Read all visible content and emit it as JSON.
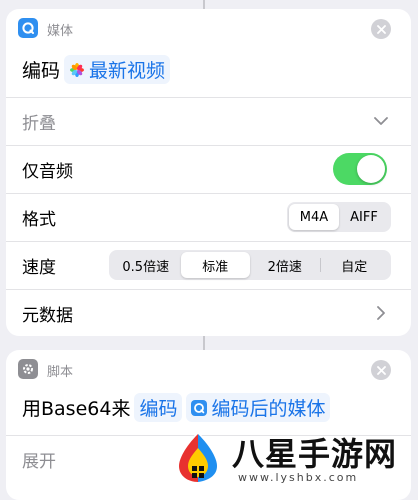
{
  "action1": {
    "app_label": "媒体",
    "verb": "编码",
    "variable": "最新视频",
    "collapse_label": "折叠",
    "audio_only": {
      "label": "仅音频",
      "enabled": true
    },
    "format": {
      "label": "格式",
      "options": [
        "M4A",
        "AIFF"
      ],
      "selected": "M4A"
    },
    "speed": {
      "label": "速度",
      "options": [
        "0.5倍速",
        "标准",
        "2倍速",
        "自定"
      ],
      "selected": "标准"
    },
    "metadata_label": "元数据"
  },
  "action2": {
    "app_label": "脚本",
    "prefix": "用Base64来",
    "verb_token": "编码",
    "variable": "编码后的媒体",
    "expand_label": "展开"
  },
  "watermark": {
    "brand": "八星手游网",
    "url": "www.lyshbx.com"
  },
  "colors": {
    "accent_blue": "#1a74e8",
    "toggle_green": "#4cd964",
    "media_icon": "#2f8ff0",
    "script_icon": "#8e8e93"
  }
}
